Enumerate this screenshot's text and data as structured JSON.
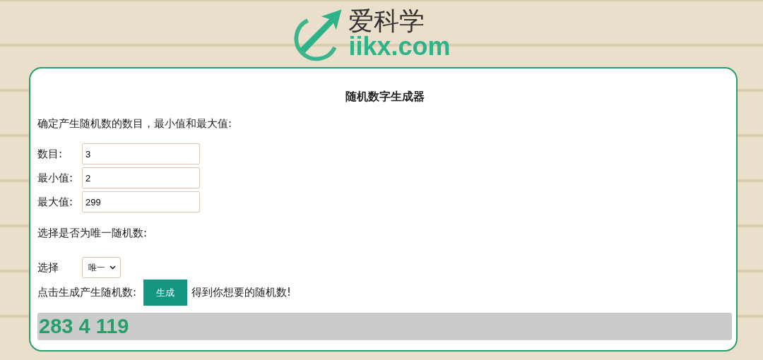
{
  "logo": {
    "name": "爱科学",
    "domain": "iikx.com"
  },
  "title": "随机数字生成器",
  "intro": "确定产生随机数的数目，最小值和最大值:",
  "fields": [
    {
      "label": "数目:",
      "value": "3"
    },
    {
      "label": "最小值:",
      "value": "2"
    },
    {
      "label": "最大值:",
      "value": "299"
    }
  ],
  "unique_prompt": "选择是否为唯一随机数:",
  "select": {
    "label": "选择",
    "value": "唯一"
  },
  "generate": {
    "prompt": "点击生成产生随机数:",
    "button": "生成",
    "suffix": "得到你想要的随机数!"
  },
  "result": "283 4 119"
}
